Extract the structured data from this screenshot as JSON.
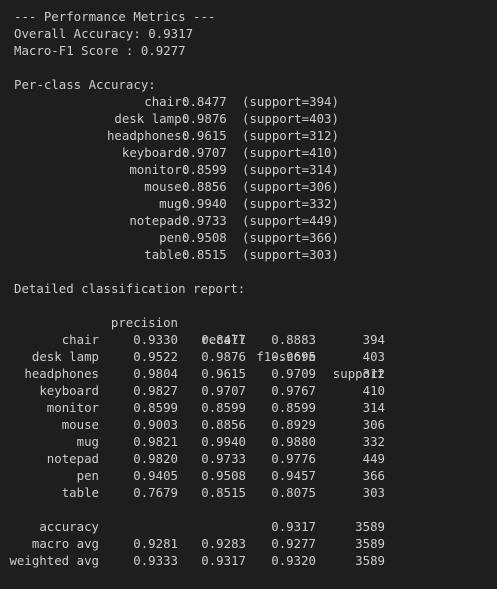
{
  "header": "--- Performance Metrics ---",
  "overall_accuracy": "Overall Accuracy: 0.9317",
  "macro_f1": "Macro-F1 Score : 0.9277",
  "per_class_title": "Per-class Accuracy:",
  "per_class": [
    {
      "name": "chair:",
      "acc": "0.8477",
      "support": "(support=394)"
    },
    {
      "name": "desk lamp:",
      "acc": "0.9876",
      "support": "(support=403)"
    },
    {
      "name": "headphones:",
      "acc": "0.9615",
      "support": "(support=312)"
    },
    {
      "name": "keyboard:",
      "acc": "0.9707",
      "support": "(support=410)"
    },
    {
      "name": "monitor:",
      "acc": "0.8599",
      "support": "(support=314)"
    },
    {
      "name": "mouse:",
      "acc": "0.8856",
      "support": "(support=306)"
    },
    {
      "name": "mug:",
      "acc": "0.9940",
      "support": "(support=332)"
    },
    {
      "name": "notepad:",
      "acc": "0.9733",
      "support": "(support=449)"
    },
    {
      "name": "pen:",
      "acc": "0.9508",
      "support": "(support=366)"
    },
    {
      "name": "table:",
      "acc": "0.8515",
      "support": "(support=303)"
    }
  ],
  "report_title": "Detailed classification report:",
  "report_headers": {
    "precision": "precision",
    "recall": "recall",
    "f1": "f1-score",
    "support": "support"
  },
  "report_rows": [
    {
      "label": "chair",
      "precision": "0.9330",
      "recall": "0.8477",
      "f1": "0.8883",
      "support": "394"
    },
    {
      "label": "desk lamp",
      "precision": "0.9522",
      "recall": "0.9876",
      "f1": "0.9695",
      "support": "403"
    },
    {
      "label": "headphones",
      "precision": "0.9804",
      "recall": "0.9615",
      "f1": "0.9709",
      "support": "312"
    },
    {
      "label": "keyboard",
      "precision": "0.9827",
      "recall": "0.9707",
      "f1": "0.9767",
      "support": "410"
    },
    {
      "label": "monitor",
      "precision": "0.8599",
      "recall": "0.8599",
      "f1": "0.8599",
      "support": "314"
    },
    {
      "label": "mouse",
      "precision": "0.9003",
      "recall": "0.8856",
      "f1": "0.8929",
      "support": "306"
    },
    {
      "label": "mug",
      "precision": "0.9821",
      "recall": "0.9940",
      "f1": "0.9880",
      "support": "332"
    },
    {
      "label": "notepad",
      "precision": "0.9820",
      "recall": "0.9733",
      "f1": "0.9776",
      "support": "449"
    },
    {
      "label": "pen",
      "precision": "0.9405",
      "recall": "0.9508",
      "f1": "0.9457",
      "support": "366"
    },
    {
      "label": "table",
      "precision": "0.7679",
      "recall": "0.8515",
      "f1": "0.8075",
      "support": "303"
    }
  ],
  "summary_rows": [
    {
      "label": "accuracy",
      "precision": "",
      "recall": "",
      "f1": "0.9317",
      "support": "3589"
    },
    {
      "label": "macro avg",
      "precision": "0.9281",
      "recall": "0.9283",
      "f1": "0.9277",
      "support": "3589"
    },
    {
      "label": "weighted avg",
      "precision": "0.9333",
      "recall": "0.9317",
      "f1": "0.9320",
      "support": "3589"
    }
  ]
}
